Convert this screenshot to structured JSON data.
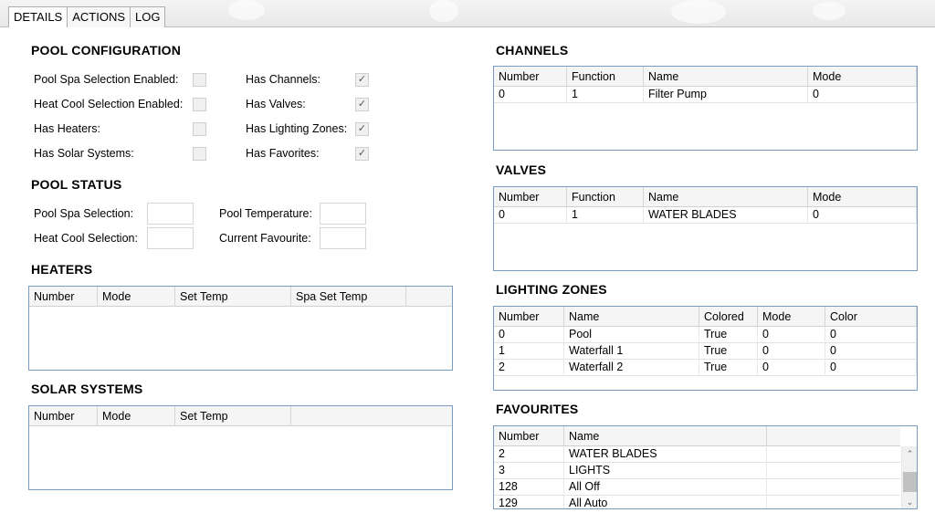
{
  "tabs": [
    {
      "label": "DETAILS",
      "active": true
    },
    {
      "label": "ACTIONS",
      "active": false
    },
    {
      "label": "LOG",
      "active": false
    }
  ],
  "pool_configuration": {
    "title": "POOL CONFIGURATION",
    "left": [
      {
        "label": "Pool Spa Selection Enabled:",
        "checked": false
      },
      {
        "label": "Heat Cool Selection Enabled:",
        "checked": false
      },
      {
        "label": "Has Heaters:",
        "checked": false
      },
      {
        "label": "Has Solar Systems:",
        "checked": false
      }
    ],
    "right": [
      {
        "label": "Has Channels:",
        "checked": true
      },
      {
        "label": "Has Valves:",
        "checked": true
      },
      {
        "label": "Has Lighting Zones:",
        "checked": true
      },
      {
        "label": "Has Favorites:",
        "checked": true
      }
    ],
    "check_glyph": "✓"
  },
  "pool_status": {
    "title": "POOL STATUS",
    "pool_spa_selection": {
      "label": "Pool Spa Selection:",
      "value": ""
    },
    "heat_cool_selection": {
      "label": "Heat Cool Selection:",
      "value": ""
    },
    "pool_temperature": {
      "label": "Pool Temperature:",
      "value": ""
    },
    "current_favourite": {
      "label": "Current Favourite:",
      "value": ""
    }
  },
  "heaters": {
    "title": "HEATERS",
    "columns": [
      "Number",
      "Mode",
      "Set Temp",
      "Spa Set Temp"
    ],
    "rows": []
  },
  "solar_systems": {
    "title": "SOLAR SYSTEMS",
    "columns": [
      "Number",
      "Mode",
      "Set Temp"
    ],
    "rows": []
  },
  "channels": {
    "title": "CHANNELS",
    "columns": [
      "Number",
      "Function",
      "Name",
      "Mode"
    ],
    "rows": [
      [
        "0",
        "1",
        "Filter Pump",
        "0"
      ]
    ]
  },
  "valves": {
    "title": "VALVES",
    "columns": [
      "Number",
      "Function",
      "Name",
      "Mode"
    ],
    "rows": [
      [
        "0",
        "1",
        "WATER BLADES",
        "0"
      ]
    ]
  },
  "lighting_zones": {
    "title": "LIGHTING ZONES",
    "columns": [
      "Number",
      "Name",
      "Colored",
      "Mode",
      "Color"
    ],
    "rows": [
      [
        "0",
        "Pool",
        "True",
        "0",
        "0"
      ],
      [
        "1",
        "Waterfall 1",
        "True",
        "0",
        "0"
      ],
      [
        "2",
        "Waterfall 2",
        "True",
        "0",
        "0"
      ]
    ]
  },
  "favourites": {
    "title": "FAVOURITES",
    "columns": [
      "Number",
      "Name"
    ],
    "rows": [
      [
        "2",
        "WATER BLADES"
      ],
      [
        "3",
        "LIGHTS"
      ],
      [
        "128",
        "All Off"
      ],
      [
        "129",
        "All Auto"
      ]
    ],
    "scroll_up_glyph": "⌃",
    "scroll_down_glyph": "⌄"
  }
}
